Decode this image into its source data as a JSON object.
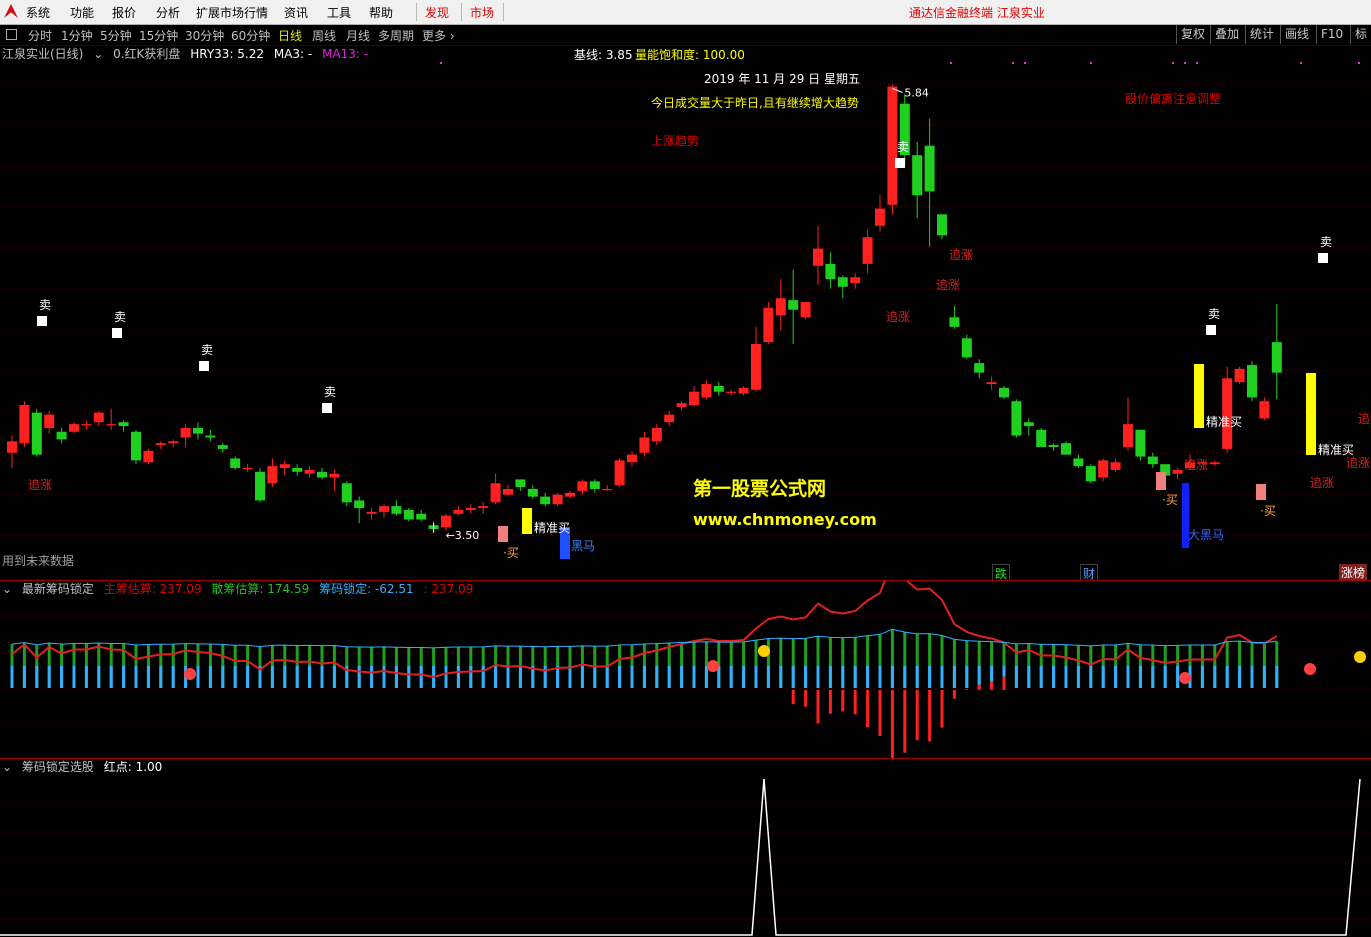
{
  "menubar": {
    "items": [
      "系统",
      "功能",
      "报价",
      "分析",
      "扩展市场行情",
      "资讯",
      "工具",
      "帮助"
    ],
    "hot_items": [
      "发现",
      "市场"
    ],
    "brand": "通达信金融终端  江泉实业",
    "window_buttons": [
      "—",
      "☐",
      "✕"
    ]
  },
  "periodbar": {
    "periods": [
      "分时",
      "1分钟",
      "5分钟",
      "15分钟",
      "30分钟",
      "60分钟",
      "日线",
      "周线",
      "月线",
      "多周期",
      "更多"
    ],
    "active": "日线",
    "right_buttons": [
      "复权",
      "叠加",
      "统计",
      "画线",
      "F10",
      "标记"
    ]
  },
  "main": {
    "title": "江泉实业(日线)",
    "hdr_item1": "0.红K获利盘",
    "hdr_hry": "HRY33: 5.22",
    "hdr_ma3": "MA3: -",
    "hdr_ma13": "MA13: -",
    "baseline": "基线: 3.85",
    "energy": "量能饱和度: 100.00",
    "date": "2019 年 11 月 29 日 星期五",
    "volume_note": "今日成交量大于昨日,且有继续增大趋势",
    "trend": "上涨趋势",
    "deviation": "股价偏离注意调整",
    "watermark1": "第一股票公式网",
    "watermark2": "www.chnmoney.com",
    "future_data": "用到未来数据",
    "high_label": "5.84",
    "low_label": "3.50",
    "labels": {
      "sell": "卖",
      "chase": "追涨",
      "buy": "买",
      "precise_buy": "精准买",
      "dark_horse": "黑马",
      "big_dark_horse": "大黑马",
      "fall": "跌",
      "fin": "财",
      "limit_list": "涨榜"
    }
  },
  "chip": {
    "title": "最新筹码锁定",
    "main": "主筹估算: 237.09",
    "retail": "散筹估算: 174.59",
    "lock": "筹码锁定: -62.51",
    "value": ": 237.09"
  },
  "redpoint": {
    "title": "筹码锁定选股",
    "point": "红点: 1.00"
  },
  "chart_data": {
    "type": "candlestick",
    "ylim": [
      3.3,
      6.0
    ],
    "candles": [
      [
        3.92,
        3.98,
        3.84,
        4.01
      ],
      [
        3.97,
        4.17,
        3.95,
        4.19
      ],
      [
        4.13,
        3.91,
        3.9,
        4.15
      ],
      [
        4.05,
        4.12,
        4.02,
        4.14
      ],
      [
        4.03,
        3.99,
        3.97,
        4.05
      ],
      [
        4.03,
        4.07,
        4.02,
        4.08
      ],
      [
        4.07,
        4.07,
        4.04,
        4.09
      ],
      [
        4.08,
        4.13,
        4.06,
        4.14
      ],
      [
        4.07,
        4.07,
        4.04,
        4.15
      ],
      [
        4.08,
        4.06,
        4.03,
        4.09
      ],
      [
        4.03,
        3.88,
        3.86,
        4.04
      ],
      [
        3.87,
        3.93,
        3.86,
        3.94
      ],
      [
        3.96,
        3.97,
        3.94,
        3.98
      ],
      [
        3.97,
        3.98,
        3.95,
        3.99
      ],
      [
        4.0,
        4.05,
        3.95,
        4.07
      ],
      [
        4.05,
        4.02,
        3.99,
        4.08
      ],
      [
        4.01,
        4.0,
        3.98,
        4.04
      ],
      [
        3.96,
        3.94,
        3.92,
        3.97
      ],
      [
        3.89,
        3.84,
        3.83,
        3.9
      ],
      [
        3.84,
        3.84,
        3.82,
        3.86
      ],
      [
        3.82,
        3.67,
        3.66,
        3.84
      ],
      [
        3.76,
        3.85,
        3.74,
        3.89
      ],
      [
        3.84,
        3.86,
        3.8,
        3.88
      ],
      [
        3.84,
        3.82,
        3.8,
        3.86
      ],
      [
        3.81,
        3.83,
        3.79,
        3.85
      ],
      [
        3.82,
        3.79,
        3.78,
        3.84
      ],
      [
        3.79,
        3.81,
        3.72,
        3.83
      ],
      [
        3.76,
        3.66,
        3.64,
        3.77
      ],
      [
        3.67,
        3.63,
        3.55,
        3.69
      ],
      [
        3.6,
        3.61,
        3.57,
        3.63
      ],
      [
        3.61,
        3.64,
        3.58,
        3.65
      ],
      [
        3.64,
        3.6,
        3.59,
        3.67
      ],
      [
        3.62,
        3.57,
        3.56,
        3.63
      ],
      [
        3.6,
        3.57,
        3.56,
        3.62
      ],
      [
        3.54,
        3.52,
        3.51,
        3.56
      ],
      [
        3.53,
        3.59,
        3.51,
        3.6
      ],
      [
        3.6,
        3.62,
        3.59,
        3.64
      ],
      [
        3.62,
        3.63,
        3.6,
        3.65
      ],
      [
        3.63,
        3.64,
        3.6,
        3.66
      ],
      [
        3.66,
        3.76,
        3.65,
        3.81
      ],
      [
        3.7,
        3.73,
        3.69,
        3.75
      ],
      [
        3.78,
        3.74,
        3.72,
        3.78
      ],
      [
        3.73,
        3.69,
        3.68,
        3.75
      ],
      [
        3.69,
        3.65,
        3.64,
        3.71
      ],
      [
        3.65,
        3.7,
        3.64,
        3.71
      ],
      [
        3.69,
        3.71,
        3.68,
        3.72
      ],
      [
        3.72,
        3.77,
        3.7,
        3.78
      ],
      [
        3.77,
        3.73,
        3.71,
        3.78
      ],
      [
        3.73,
        3.73,
        3.72,
        3.75
      ],
      [
        3.75,
        3.88,
        3.74,
        3.89
      ],
      [
        3.87,
        3.91,
        3.85,
        3.93
      ],
      [
        3.92,
        4.0,
        3.9,
        4.03
      ],
      [
        3.98,
        4.05,
        3.96,
        4.07
      ],
      [
        4.08,
        4.12,
        4.06,
        4.14
      ],
      [
        4.16,
        4.18,
        4.14,
        4.19
      ],
      [
        4.17,
        4.24,
        4.16,
        4.27
      ],
      [
        4.21,
        4.28,
        4.2,
        4.3
      ],
      [
        4.27,
        4.24,
        4.22,
        4.29
      ],
      [
        4.24,
        4.24,
        4.22,
        4.25
      ],
      [
        4.23,
        4.26,
        4.22,
        4.27
      ],
      [
        4.25,
        4.49,
        4.24,
        4.58
      ],
      [
        4.5,
        4.68,
        4.49,
        4.71
      ],
      [
        4.64,
        4.73,
        4.56,
        4.83
      ],
      [
        4.72,
        4.67,
        4.49,
        4.88
      ],
      [
        4.63,
        4.71,
        4.62,
        4.71
      ],
      [
        4.9,
        4.99,
        4.8,
        5.11
      ],
      [
        4.91,
        4.83,
        4.78,
        4.97
      ],
      [
        4.84,
        4.79,
        4.73,
        4.85
      ],
      [
        4.81,
        4.84,
        4.78,
        4.86
      ],
      [
        4.91,
        5.05,
        4.86,
        5.09
      ],
      [
        5.11,
        5.2,
        5.08,
        5.27
      ],
      [
        5.22,
        5.84,
        5.17,
        5.85
      ],
      [
        5.75,
        5.48,
        5.43,
        5.8
      ],
      [
        5.48,
        5.27,
        5.15,
        5.55
      ],
      [
        5.53,
        5.29,
        5.0,
        5.67
      ],
      [
        5.17,
        5.06,
        5.04,
        5.16
      ],
      [
        4.63,
        4.58,
        4.57,
        4.69
      ],
      [
        4.52,
        4.42,
        4.41,
        4.54
      ],
      [
        4.39,
        4.34,
        4.31,
        4.41
      ],
      [
        4.28,
        4.29,
        4.25,
        4.32
      ],
      [
        4.26,
        4.21,
        4.2,
        4.27
      ],
      [
        4.19,
        4.01,
        4.0,
        4.2
      ],
      [
        4.08,
        4.06,
        4.01,
        4.1
      ],
      [
        4.04,
        3.95,
        3.95,
        4.05
      ],
      [
        3.96,
        3.95,
        3.93,
        3.97
      ],
      [
        3.97,
        3.91,
        3.91,
        3.98
      ],
      [
        3.89,
        3.85,
        3.84,
        3.91
      ],
      [
        3.85,
        3.77,
        3.76,
        3.86
      ],
      [
        3.79,
        3.88,
        3.77,
        3.89
      ],
      [
        3.83,
        3.87,
        3.82,
        3.89
      ],
      [
        3.95,
        4.07,
        3.93,
        4.21
      ],
      [
        4.04,
        3.9,
        3.88,
        4.04
      ],
      [
        3.9,
        3.86,
        3.84,
        3.92
      ],
      [
        3.86,
        3.8,
        3.8,
        3.85
      ],
      [
        3.81,
        3.83,
        3.78,
        3.84
      ],
      [
        3.84,
        3.87,
        3.83,
        3.91
      ],
      [
        3.87,
        3.87,
        3.86,
        3.87
      ],
      [
        3.86,
        3.87,
        3.85,
        3.88
      ],
      [
        3.94,
        4.31,
        3.92,
        4.37
      ],
      [
        4.29,
        4.36,
        4.28,
        4.37
      ],
      [
        4.38,
        4.21,
        4.19,
        4.4
      ],
      [
        4.1,
        4.19,
        4.09,
        4.21
      ],
      [
        4.5,
        4.34,
        4.2,
        4.7
      ]
    ]
  }
}
